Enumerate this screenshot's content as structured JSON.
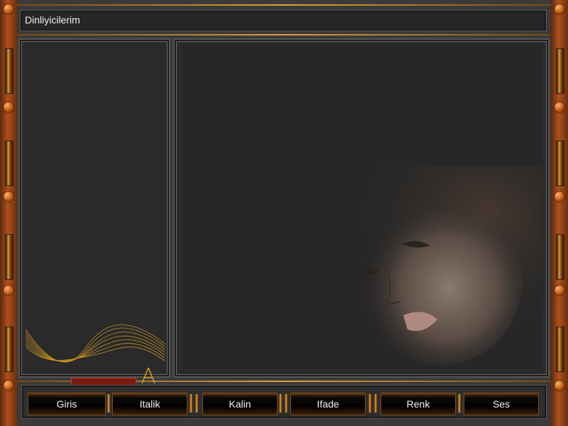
{
  "window": {
    "title": "Dinliyicilerim"
  },
  "toolbar": {
    "buttons": [
      {
        "label": "Giris"
      },
      {
        "label": "Italik"
      },
      {
        "label": "Kalin"
      },
      {
        "label": "Ifade"
      },
      {
        "label": "Renk"
      },
      {
        "label": "Ses"
      }
    ]
  },
  "colors": {
    "accent": "#c8801e",
    "rail": "#b0501a",
    "panel": "#2b2b2b"
  },
  "icons": {
    "rivet": "rivet-icon",
    "wave": "wave-ornament-icon",
    "logo": "logo-mark-icon"
  }
}
